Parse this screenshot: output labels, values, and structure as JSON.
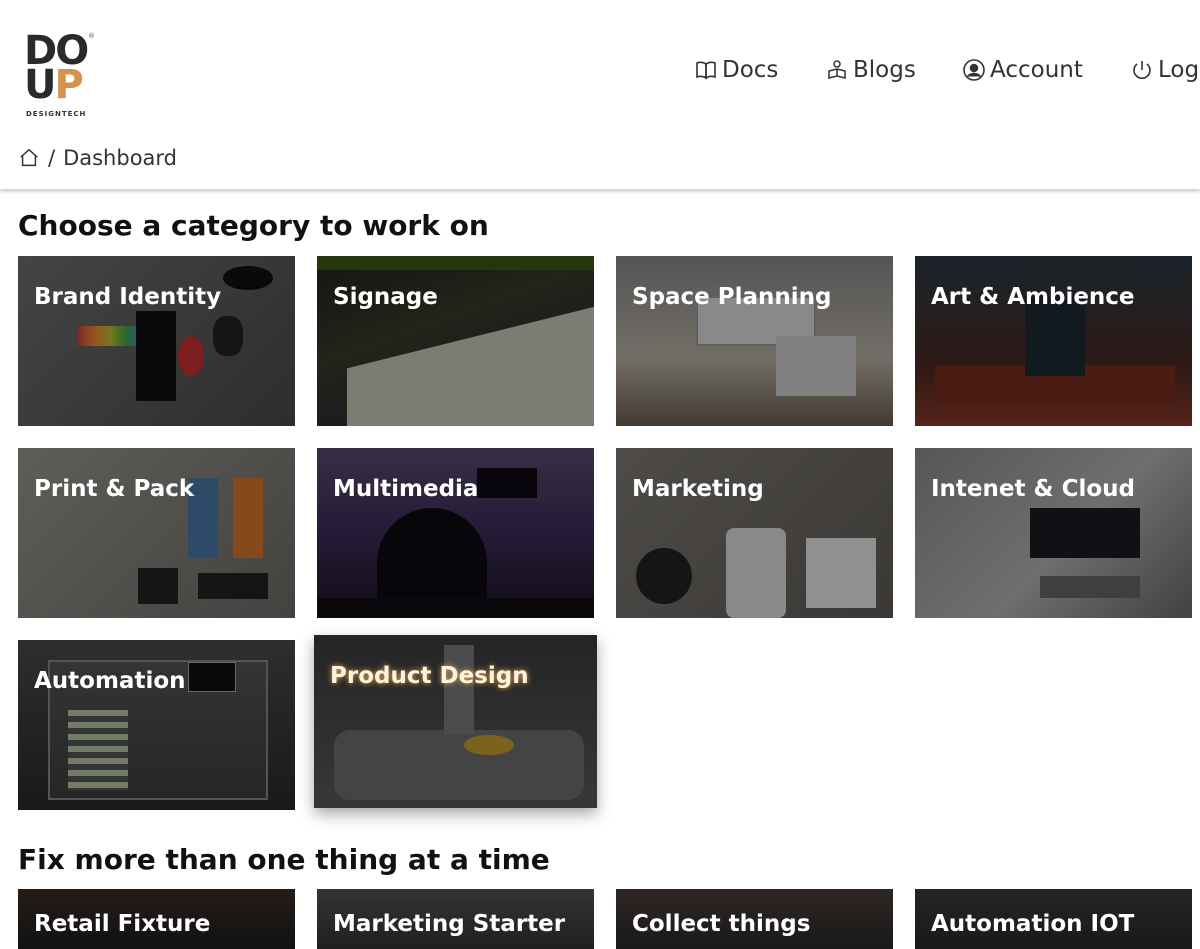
{
  "brand": {
    "logo_line1": "DO",
    "logo_u": "U",
    "logo_p": "P",
    "logo_tagline": "DESIGNTECH",
    "registered_mark": "®",
    "accent_color": "#d4924a"
  },
  "nav": {
    "docs": "Docs",
    "blogs": "Blogs",
    "account": "Account",
    "logout": "Log"
  },
  "breadcrumb": {
    "separator": "/",
    "current": "Dashboard"
  },
  "categories": {
    "title": "Choose a category to work on",
    "items": [
      {
        "label": "Brand Identity"
      },
      {
        "label": "Signage"
      },
      {
        "label": "Space Planning"
      },
      {
        "label": "Art & Ambience"
      },
      {
        "label": "Print & Pack"
      },
      {
        "label": "Multimedia"
      },
      {
        "label": "Marketing"
      },
      {
        "label": "Intenet & Cloud"
      },
      {
        "label": "Automation"
      },
      {
        "label": "Product Design"
      }
    ]
  },
  "multi": {
    "title": "Fix more than one thing at a time",
    "items": [
      {
        "label": "Retail Fixture"
      },
      {
        "label": "Marketing Starter"
      },
      {
        "label": "Collect things"
      },
      {
        "label": "Automation IOT"
      }
    ]
  }
}
